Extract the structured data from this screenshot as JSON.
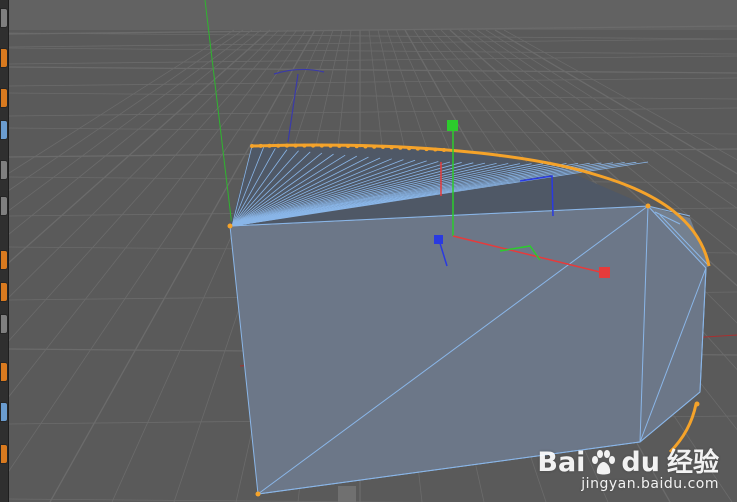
{
  "viewport": {
    "background_color": "#5a5a5a",
    "grid_color": "#6b6b6b",
    "object_color": "#6d7889",
    "wire_color": "#8ab6e8",
    "spline_color": "#f5a32a",
    "axis_x_color": "#e63b3b",
    "axis_y_color": "#2ccc2c",
    "axis_z_color": "#2a3ae0"
  },
  "toolbar": {
    "icons": [
      "cube-icon",
      "cube-icon",
      "arrow-icon",
      "pen-icon",
      "cube-icon",
      "cube-icon",
      "deformer-icon",
      "camera-icon",
      "light-icon",
      "scene-icon",
      "tag-icon"
    ]
  },
  "watermark": {
    "brand": "Bai",
    "brand_suffix": "du",
    "chinese": "经验",
    "url": "jingyan.baidu.com"
  }
}
